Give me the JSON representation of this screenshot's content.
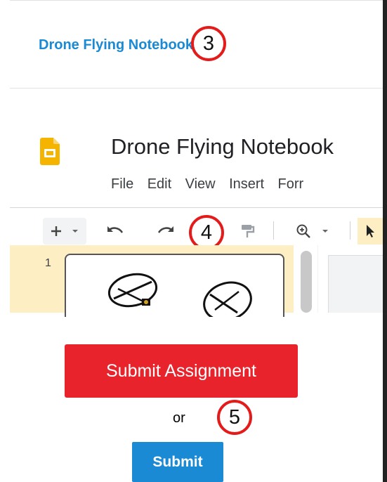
{
  "link": {
    "text": "Drone Flying Notebook"
  },
  "callouts": [
    "3",
    "4",
    "5"
  ],
  "slides": {
    "title": "Drone Flying Notebook",
    "menu": [
      "File",
      "Edit",
      "View",
      "Insert",
      "Forr"
    ],
    "toolbar_icons": [
      "plus-icon",
      "chevron-down-icon",
      "undo-icon",
      "redo-icon",
      "paint-format-icon",
      "zoom-icon",
      "chevron-down-icon",
      "select-cursor-icon"
    ],
    "slide_number": "1",
    "logo_color": "#f4b400"
  },
  "submit": {
    "assignment_label": "Submit Assignment",
    "or_text": "or",
    "button_label": "Submit",
    "red": "#e8232b",
    "blue": "#1a8ad4"
  }
}
